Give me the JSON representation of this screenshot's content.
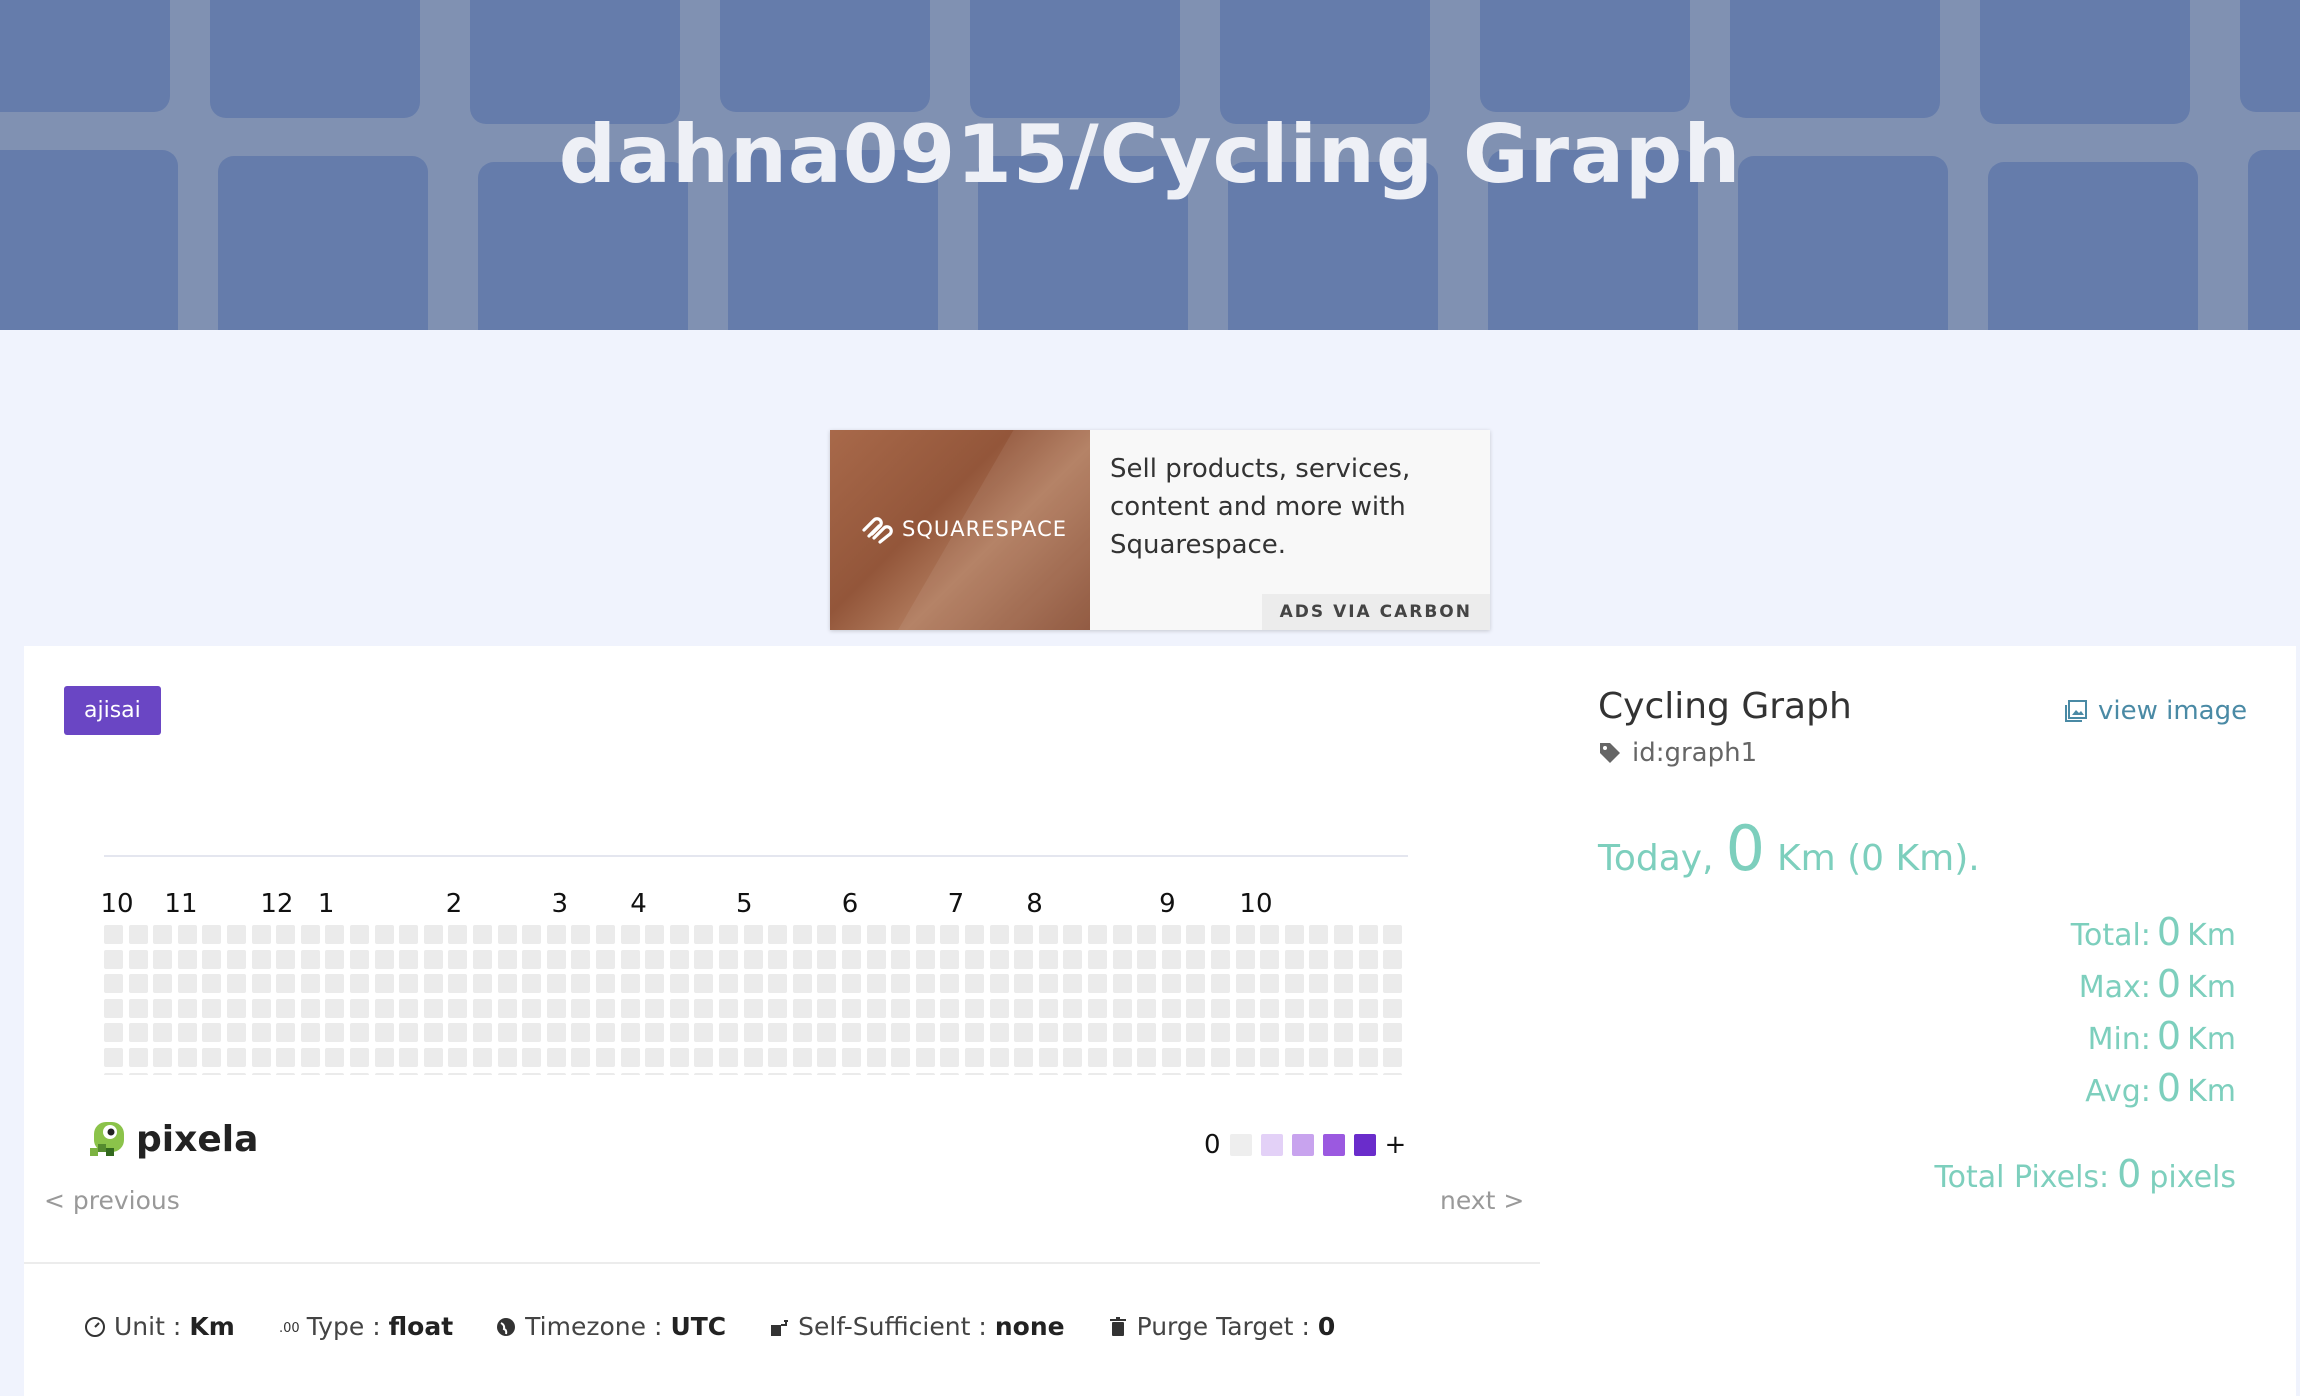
{
  "header": {
    "title": "dahna0915/Cycling Graph"
  },
  "ad": {
    "brand": "SQUARESPACE",
    "text": "Sell products, services, content and more with Squarespace.",
    "via": "ADS VIA CARBON"
  },
  "theme_chip": "ajisai",
  "graph": {
    "months": [
      "10",
      "11",
      "12",
      "1",
      "2",
      "3",
      "4",
      "5",
      "6",
      "7",
      "8",
      "9",
      "10"
    ],
    "legend_min": "0",
    "legend_max": "+",
    "legend_colors": [
      "#eeeeee",
      "#e3d1f7",
      "#c8a3ee",
      "#9b59e0",
      "#6a2ccb"
    ],
    "cell_color": "#ebebeb",
    "brand": "pixela",
    "prev": "< previous",
    "next": "next >"
  },
  "meta": {
    "unit_label": "Unit",
    "unit": "Km",
    "type_label": "Type",
    "type": "float",
    "timezone_label": "Timezone",
    "timezone": "UTC",
    "self_label": "Self-Sufficient",
    "self": "none",
    "purge_label": "Purge Target",
    "purge": "0",
    "sep": ":"
  },
  "panel": {
    "title": "Cycling Graph",
    "id": "id:graph1",
    "view_image": "view image",
    "today_label": "Today,",
    "today_value": "0",
    "today_unit": "Km (0 Km).",
    "stats": [
      {
        "label": "Total:",
        "value": "0",
        "unit": "Km"
      },
      {
        "label": "Max:",
        "value": "0",
        "unit": "Km"
      },
      {
        "label": "Min:",
        "value": "0",
        "unit": "Km"
      },
      {
        "label": "Avg:",
        "value": "0",
        "unit": "Km"
      }
    ],
    "total_pixels_label": "Total Pixels:",
    "total_pixels_value": "0",
    "total_pixels_unit": "pixels"
  }
}
